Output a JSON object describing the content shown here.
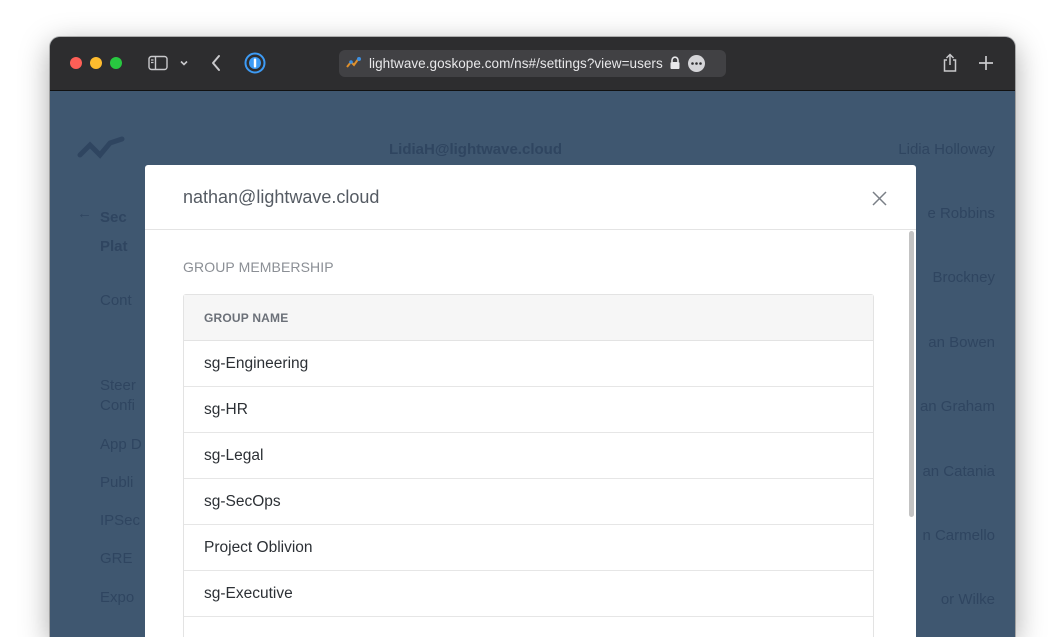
{
  "browser": {
    "url": "lightwave.goskope.com/ns#/settings?view=users",
    "icons": {
      "sidebar": "sidebar-icon",
      "chevron": "chevron-down-icon",
      "back": "back-arrow-icon",
      "password_manager": "password-manager-icon",
      "lock": "lock-icon",
      "more": "ellipsis-icon",
      "share": "share-icon",
      "new_tab": "plus-icon"
    },
    "colors": {
      "toolbar": "#2d2d2f",
      "close": "#fe5f57",
      "minimize": "#febc2e",
      "zoom": "#28c840",
      "password_manager": "#3d9bf5"
    }
  },
  "background_page": {
    "title_lines": [
      "Sec",
      "Plat"
    ],
    "nav_items": [
      "Cont",
      "",
      "Steer",
      "Confi",
      "App D",
      "Publi",
      "IPSec",
      "GRE",
      "Expo"
    ],
    "user_email": "LidiaH@lightwave.cloud",
    "user_names": [
      "Lidia Holloway",
      "e Robbins",
      "Brockney",
      "an Bowen",
      "an Graham",
      "an Catania",
      "n Carmello",
      "or Wilke"
    ],
    "overlay_color": "#3f5770"
  },
  "modal": {
    "title": "nathan@lightwave.cloud",
    "close_icon": "close-icon",
    "section_label": "GROUP MEMBERSHIP",
    "table": {
      "header": "GROUP NAME",
      "rows": [
        "sg-Engineering",
        "sg-HR",
        "sg-Legal",
        "sg-SecOps",
        "Project Oblivion",
        "sg-Executive",
        ""
      ]
    }
  }
}
